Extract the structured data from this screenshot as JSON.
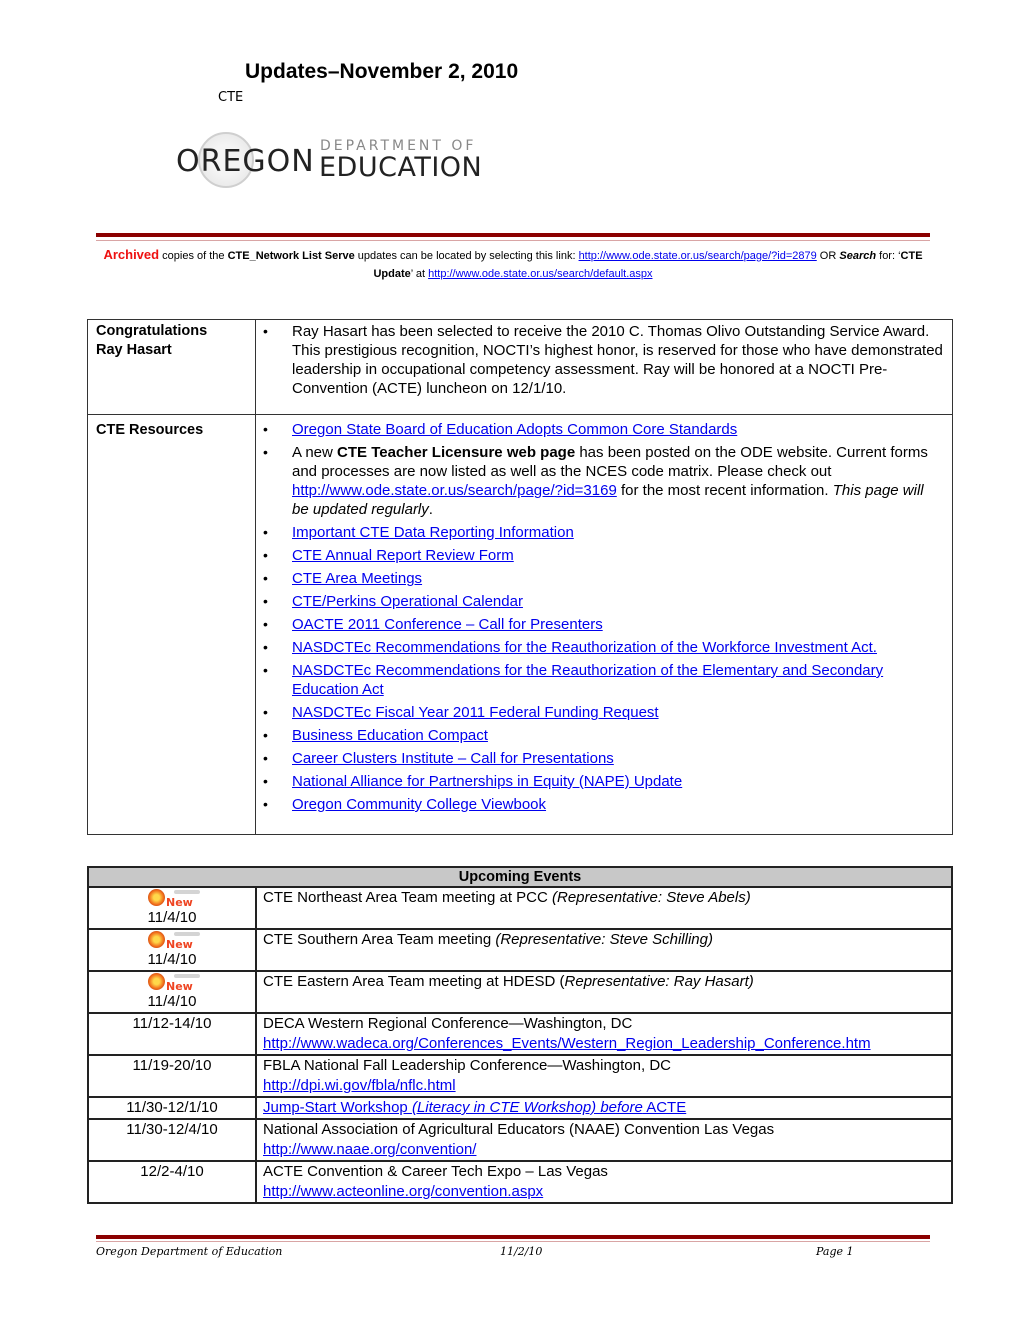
{
  "header": {
    "title": "Updates–November 2, 2010",
    "subtitle": "CTE",
    "logo": {
      "seal_icon": "oregon-state-seal-icon",
      "oregon": "OREGON",
      "department_of": "DEPARTMENT  OF",
      "education": "EDUCATION"
    }
  },
  "archive": {
    "archived_label": "Archived",
    "text1": " copies of the ",
    "list_name": "CTE_Network List Serve",
    "text2": " updates can be located by selecting this link: ",
    "link1": "http://www.ode.state.or.us/search/page/?id=2879",
    "text3": " OR ",
    "search_label": "Search",
    "text4": " for: ‘",
    "search_term": "CTE Update",
    "text5": "’ at ",
    "link2": "http://www.ode.state.or.us/search/default.aspx"
  },
  "news": {
    "congrats": {
      "label_line1": "Congratulations",
      "label_line2": "Ray Hasart",
      "text": "Ray Hasart has been selected to receive the 2010 C. Thomas Olivo Outstanding Service Award.  This prestigious recognition, NOCTI’s highest honor, is reserved for those who have demonstrated leadership in occupational competency assessment.  Ray will be honored at a NOCTI Pre-Convention (ACTE) luncheon on 12/1/10."
    },
    "resources": {
      "label": "CTE Resources",
      "link_first": "Oregon State Board of Education Adopts Common Core Standards",
      "licensure": {
        "prefix": "A new ",
        "bold": "CTE Teacher Licensure web page",
        "mid": " has been posted on the ODE website.  Current forms and processes are now listed as well as the NCES code matrix. Please check out ",
        "link": "http://www.ode.state.or.us/search/page/?id=3169",
        "suffix": " for the most recent information.  ",
        "italic": "This page will be updated regularly",
        "end": "."
      },
      "links": [
        "Important CTE Data Reporting Information",
        "CTE Annual Report Review Form",
        "CTE Area Meetings",
        "CTE/Perkins Operational Calendar",
        "OACTE 2011 Conference – Call for Presenters",
        "NASDCTEc Recommendations for the Reauthorization of the Workforce Investment Act.",
        "NASDCTEc Recommendations for the Reauthorization of the Elementary and Secondary Education Act",
        "NASDCTEc Fiscal Year 2011 Federal Funding Request",
        "Business Education Compact",
        "Career Clusters Institute – Call for Presentations",
        "National Alliance for Partnerships in Equity (NAPE) Update",
        "Oregon Community College Viewbook"
      ]
    }
  },
  "events": {
    "header": "Upcoming Events",
    "new_badge": "New",
    "rows": [
      {
        "date": "11/4/10",
        "is_new": true,
        "text": "CTE Northeast Area Team meeting at PCC ",
        "italic": "(Representative: Steve Abels)"
      },
      {
        "date": "11/4/10",
        "is_new": true,
        "text": "CTE Southern Area Team meeting ",
        "italic": "(Representative: Steve Schilling)"
      },
      {
        "date": "11/4/10",
        "is_new": true,
        "text": "CTE Eastern Area Team meeting at HDESD (",
        "italic": "Representative: Ray Hasart)"
      },
      {
        "date": "11/12-14/10",
        "text": "DECA Western Regional Conference—Washington, DC",
        "link": "http://www.wadeca.org/Conferences_Events/Western_Region_Leadership_Conference.htm"
      },
      {
        "date": "11/19-20/10",
        "text": "FBLA National Fall Leadership Conference—Washington, DC",
        "link": "http://dpi.wi.gov/fbla/nflc.html"
      },
      {
        "date": "11/30-12/1/10",
        "link_a": "Jump-Start Workshop ",
        "link_b": "(Literacy in CTE Workshop) before",
        "link_c": " ACTE"
      },
      {
        "date": "11/30-12/4/10",
        "text": "National Association of Agricultural Educators (NAAE) Convention Las Vegas",
        "link": "http://www.naae.org/convention/"
      },
      {
        "date": "12/2-4/10",
        "text": "ACTE Convention & Career Tech Expo – Las Vegas",
        "link": "http://www.acteonline.org/convention.aspx"
      }
    ]
  },
  "footer": {
    "org": "Oregon Department of Education",
    "date": "11/2/10",
    "page": "Page 1"
  },
  "colors": {
    "rule": "#8b0000",
    "archived": "#ee1111",
    "link": "#0000ee",
    "events_header_bg": "#c8c8c8"
  }
}
